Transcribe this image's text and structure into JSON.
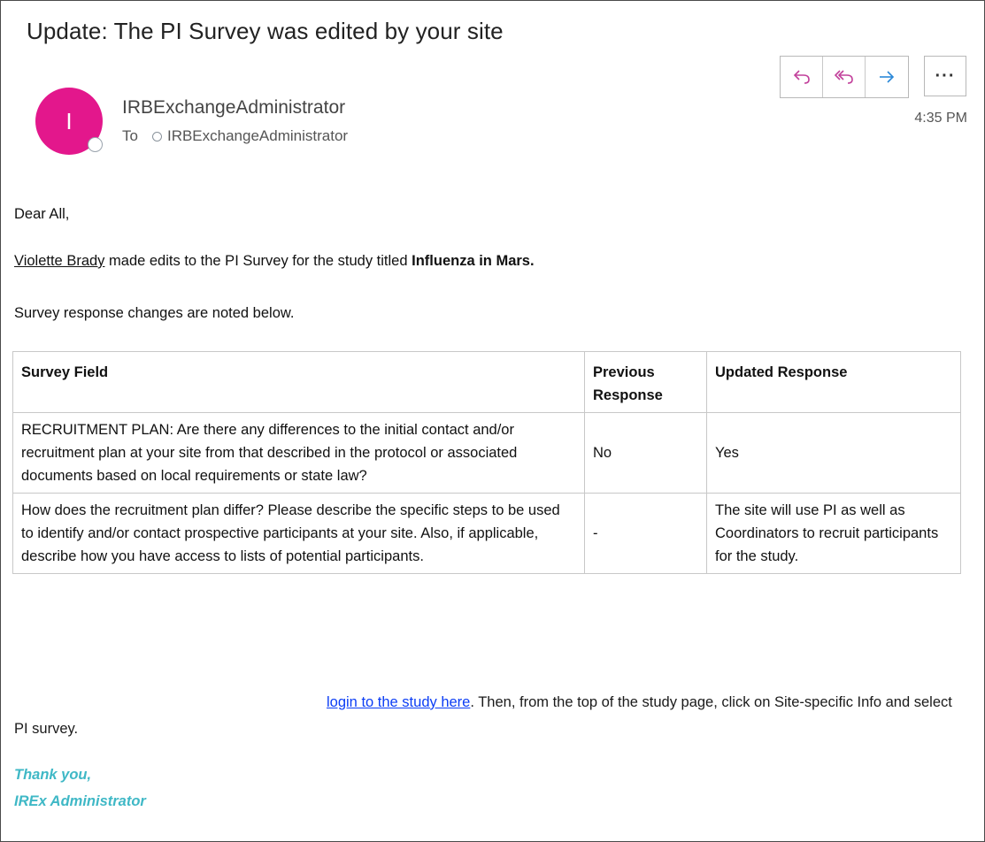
{
  "email": {
    "subject": "Update: The PI Survey was edited by your site",
    "avatar_initial": "I",
    "avatar_color": "#e3178c",
    "sender": "IRBExchangeAdministrator",
    "to_label": "To",
    "recipient": "IRBExchangeAdministrator",
    "time": "4:35 PM",
    "actions": {
      "reply_icon": "↩",
      "reply_all_icon": "«",
      "forward_icon": "→",
      "more_icon": "···"
    }
  },
  "body": {
    "greeting": "Dear All,",
    "editor_name": "Violette Brady",
    "edit_text": " made edits to the PI Survey for the study titled ",
    "study_title": "Influenza in Mars.",
    "changes_note": "Survey response changes are noted below.",
    "table": {
      "headers": [
        "Survey Field",
        "Previous Response",
        "Updated Response"
      ],
      "rows": [
        {
          "field": "RECRUITMENT PLAN: Are there any differences to the initial contact and/or recruitment plan at your site from that described in the protocol or associated documents based on local requirements or state law?",
          "previous": "No",
          "updated": "Yes"
        },
        {
          "field": "How does the recruitment plan differ? Please describe the specific steps to be used to identify and/or contact prospective participants at your site. Also, if applicable, describe how you have access to lists of potential participants.",
          "previous": "-",
          "updated": "The site will use PI as well as Coordinators to recruit participants for the study."
        }
      ]
    },
    "login_link": "login to the study here",
    "login_after": ". Then, from the top of the study page, click on Site-specific Info and select PI survey.",
    "signoff_1": "Thank you,",
    "signoff_2": "IREx Administrator"
  },
  "colors": {
    "accent_pink": "#e3178c",
    "reply_icon_color": "#c2409b",
    "forward_icon_color": "#2b88d8",
    "signature_color": "#3fb8c6",
    "link_color": "#0b3df5"
  }
}
